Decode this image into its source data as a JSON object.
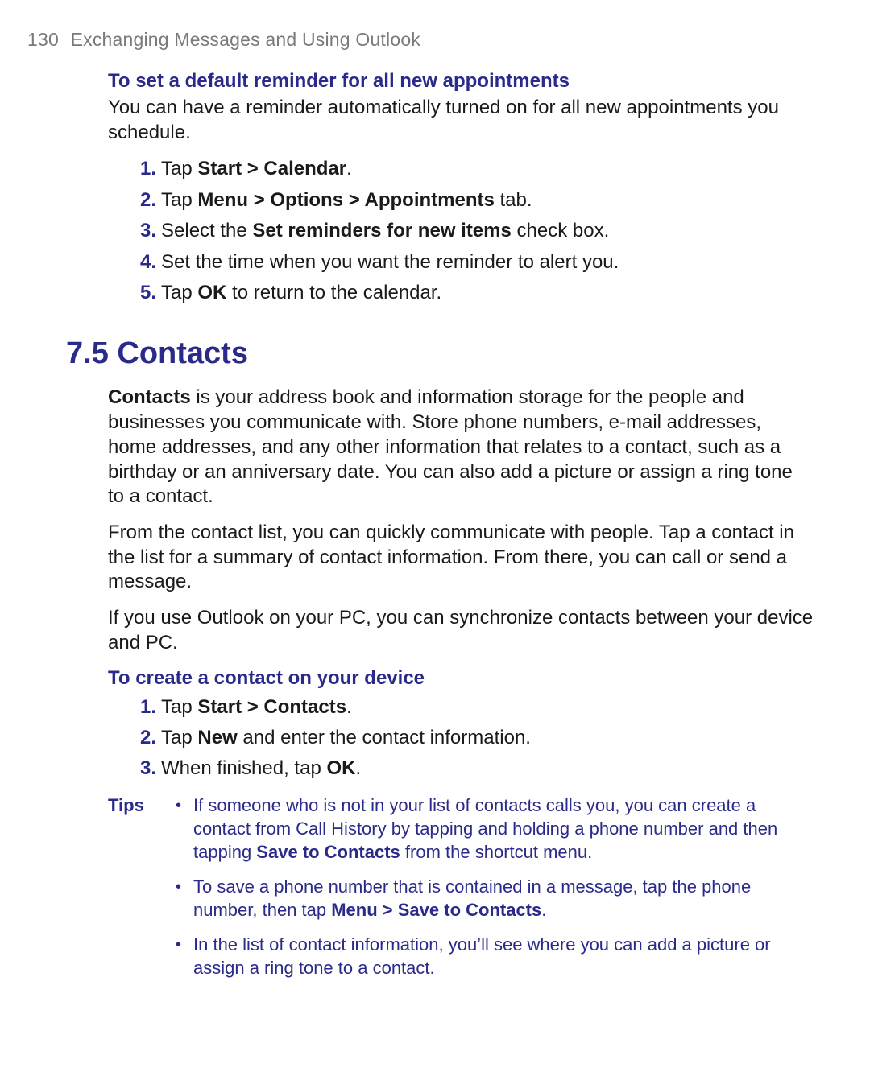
{
  "header": {
    "page_number": "130",
    "title": "Exchanging Messages and Using Outlook"
  },
  "reminder": {
    "title": "To set a default reminder for all new appointments",
    "intro": "You can have a reminder automatically turned on for all new appointments you schedule.",
    "steps": [
      {
        "num": "1.",
        "pre": "Tap ",
        "bold": "Start > Calendar",
        "post": "."
      },
      {
        "num": "2.",
        "pre": "Tap ",
        "bold": "Menu > Options > Appointments",
        "post": " tab."
      },
      {
        "num": "3.",
        "pre": "Select the ",
        "bold": "Set reminders for new items",
        "post": " check box."
      },
      {
        "num": "4.",
        "pre": "Set the time when you want the reminder to alert you.",
        "bold": "",
        "post": ""
      },
      {
        "num": "5.",
        "pre": "Tap ",
        "bold": "OK",
        "post": " to return to the calendar."
      }
    ]
  },
  "section_heading": "7.5 Contacts",
  "contacts": {
    "para1_lead": "Contacts",
    "para1_rest": " is your address book and information storage for the people and businesses you communicate with. Store phone numbers, e-mail addresses, home addresses, and any other information that relates to a contact, such as a birthday or an anniversary date. You can also add a picture or assign a ring tone to a contact.",
    "para2": "From the contact list,  you can quickly communicate with people. Tap a contact in the list for a summary of contact information. From there, you can call or send a message.",
    "para3": "If you use Outlook on your PC, you can synchronize contacts between your device and PC."
  },
  "create": {
    "title": "To create a contact on your device",
    "steps": [
      {
        "num": "1.",
        "pre": "Tap ",
        "bold": "Start > Contacts",
        "post": "."
      },
      {
        "num": "2.",
        "pre": "Tap ",
        "bold": "New",
        "post": " and enter the contact information."
      },
      {
        "num": "3.",
        "pre": "When finished, tap ",
        "bold": "OK",
        "post": "."
      }
    ]
  },
  "tips": {
    "label": "Tips",
    "items": [
      {
        "pre": "If someone who is not in your list of contacts calls you, you can create a contact from Call History by tapping and holding a phone number and then tapping ",
        "bold": "Save to Contacts",
        "post": " from the shortcut menu."
      },
      {
        "pre": "To save a phone number that is contained in a message, tap the phone number, then tap ",
        "bold": "Menu > Save to Contacts",
        "post": "."
      },
      {
        "pre": "In the list of contact information, you’ll see where you can add a picture or assign a ring tone to a contact.",
        "bold": "",
        "post": ""
      }
    ]
  }
}
